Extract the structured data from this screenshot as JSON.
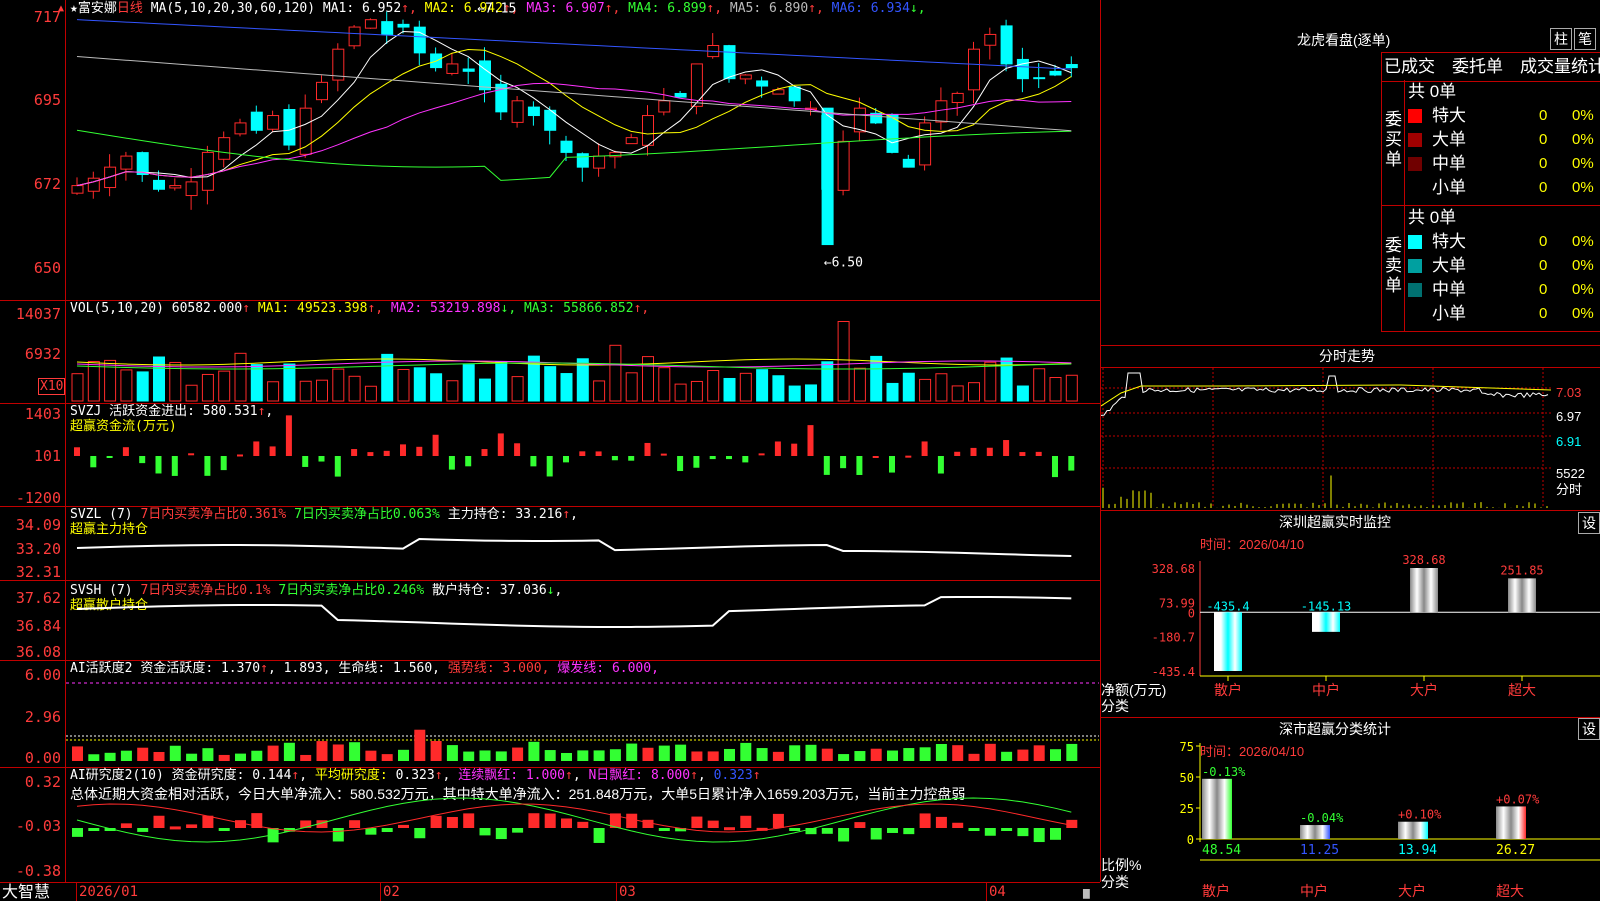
{
  "stock": {
    "star": "★",
    "name": "富安娜",
    "period": "日线",
    "ma_label": "MA(5,10,20,30,60,120)",
    "ma": [
      {
        "label": "MA1:",
        "value": "6.952",
        "arrow": "↑",
        "color": "#ffffff"
      },
      {
        "label": "MA2:",
        "value": "6.942",
        "arrow": "↑",
        "color": "#ffff00"
      },
      {
        "label": "MA3:",
        "value": "6.907",
        "arrow": "↑",
        "color": "#ff33ff"
      },
      {
        "label": "MA4:",
        "value": "6.899",
        "arrow": "↑",
        "color": "#33ff33"
      },
      {
        "label": "MA5:",
        "value": "6.890",
        "arrow": "↑",
        "color": "#bbbbbb"
      },
      {
        "label": "MA6:",
        "value": "6.934",
        "arrow": "↓",
        "color": "#3355ff"
      }
    ],
    "price_axis": [
      "717",
      "695",
      "672",
      "650"
    ],
    "high_marker": "7.15",
    "low_marker": "6.50",
    "colors": {
      "up": "#ff2a2a",
      "down": "#00ffff",
      "grid": "#c00000"
    }
  },
  "volume": {
    "title": "VOL(5,10,20)",
    "value": "60582.000",
    "arrow": "↑",
    "ma": [
      {
        "label": "MA1:",
        "value": "49523.398",
        "arrow": "↑",
        "color": "#ffff00"
      },
      {
        "label": "MA2:",
        "value": "53219.898",
        "arrow": "↓",
        "color": "#ff33ff"
      },
      {
        "label": "MA3:",
        "value": "55866.852",
        "arrow": "↑",
        "color": "#33ff33"
      }
    ],
    "axis": [
      "14037",
      "6932"
    ],
    "unit": "X10"
  },
  "svzj": {
    "title": "SVZJ",
    "label": "活跃资金进出:",
    "value": "580.531",
    "arrow": "↑",
    "comma": ",",
    "subtitle": "超赢资金流(万元)",
    "axis": [
      "1403",
      "101",
      "-1200"
    ]
  },
  "svzl": {
    "title": "SVZL (7)",
    "t1": "7日内买卖净占比0.361%",
    "t2": "7日内买卖净占比0.063%",
    "t3": "主力持仓:",
    "value": "33.216",
    "arrow": "↑",
    "comma": ",",
    "subtitle": "超赢主力持仓",
    "axis": [
      "34.09",
      "33.20",
      "32.31"
    ]
  },
  "svsh": {
    "title": "SVSH (7)",
    "t1": "7日内买卖净占比0.1%",
    "t2": "7日内买卖净占比0.246%",
    "t3": "散户持仓:",
    "value": "37.036",
    "arrow": "↓",
    "comma": ",",
    "subtitle": "超赢散户持仓",
    "axis": [
      "37.62",
      "36.84",
      "36.08"
    ]
  },
  "ai1": {
    "title": "AI活跃度2",
    "label": "资金活跃度:",
    "v1": "1.370",
    "v2": "1.893,",
    "life_label": "生命线:",
    "life": "1.560,",
    "strong": "强势线: 3.000,",
    "burst": "爆发线: 6.000,",
    "arrow": "↑",
    "axis": [
      "6.00",
      "2.96",
      "0.00"
    ]
  },
  "ai2": {
    "title": "AI研究度2(10)",
    "label": "资金研究度:",
    "v1": "0.144",
    "avg": "平均研究度:",
    "v2": "0.323",
    "cont": "连续飘红:",
    "v3": "1.000",
    "nday": "N日飘红:",
    "v4": "8.000",
    "v5": "0.323",
    "arrow": "↑",
    "summary": "总体近期大资金相对活跃，今日大单净流入：580.532万元，其中特大单净流入：251.848万元，大单5日累计净入1659.203万元，当前主力控盘弱",
    "axis": [
      "0.32",
      "-0.03",
      "-0.38"
    ]
  },
  "time_axis": {
    "brand": "大智慧",
    "labels": [
      "2026/01",
      "02",
      "03",
      "04"
    ]
  },
  "longhu": {
    "title": "龙虎看盘(逐单)",
    "btn1": "柱",
    "btn2": "笔",
    "tabs": [
      "已成交",
      "委托单",
      "成交量统计"
    ],
    "buy": {
      "side": "委买单",
      "total": "共 0单",
      "rows": [
        {
          "name": "特大",
          "count": "0",
          "pct": "0%",
          "color": "#ff0000"
        },
        {
          "name": "大单",
          "count": "0",
          "pct": "0%",
          "color": "#a00000"
        },
        {
          "name": "中单",
          "count": "0",
          "pct": "0%",
          "color": "#700000"
        },
        {
          "name": "小单",
          "count": "0",
          "pct": "0%",
          "color": "#000000"
        }
      ]
    },
    "sell": {
      "side": "委卖单",
      "total": "共 0单",
      "rows": [
        {
          "name": "特大",
          "count": "0",
          "pct": "0%",
          "color": "#00ffff"
        },
        {
          "name": "大单",
          "count": "0",
          "pct": "0%",
          "color": "#00a0a0"
        },
        {
          "name": "中单",
          "count": "0",
          "pct": "0%",
          "color": "#007070"
        },
        {
          "name": "小单",
          "count": "0",
          "pct": "0%",
          "color": "#000000"
        }
      ]
    }
  },
  "fenshi": {
    "title": "分时走势",
    "axis": [
      "7.03",
      "6.97",
      "6.91"
    ],
    "vol": "5522",
    "vol_label": "分时"
  },
  "szcy_monitor": {
    "title": "深圳超赢实时监控",
    "btn": "设",
    "time": "时间：2026/04/10",
    "axis": [
      "328.68",
      "73.99",
      "0",
      "-180.7",
      "-435.4"
    ],
    "ylabel": "净额(万元)",
    "xlabel": "分类",
    "chart_data": {
      "type": "bar",
      "categories": [
        "散户",
        "中户",
        "大户",
        "超大"
      ],
      "values": [
        -435.4,
        -145.13,
        328.68,
        251.85
      ],
      "labels": [
        "-435.4",
        "-145.13",
        "328.68",
        "251.85"
      ],
      "ylim": [
        -435.4,
        328.68
      ]
    }
  },
  "szcy_class": {
    "title": "深市超赢分类统计",
    "btn": "设",
    "time": "时间：2026/04/10",
    "axis": [
      "75",
      "50",
      "25",
      "0"
    ],
    "ylabel": "比例%",
    "xlabel": "分类",
    "chart_data": {
      "type": "bar",
      "categories": [
        "散户",
        "中户",
        "大户",
        "超大"
      ],
      "values": [
        48.54,
        11.25,
        13.94,
        26.27
      ],
      "changes": [
        "-0.13%",
        "-0.04%",
        "+0.10%",
        "+0.07%"
      ],
      "ylim": [
        0,
        75
      ]
    }
  }
}
